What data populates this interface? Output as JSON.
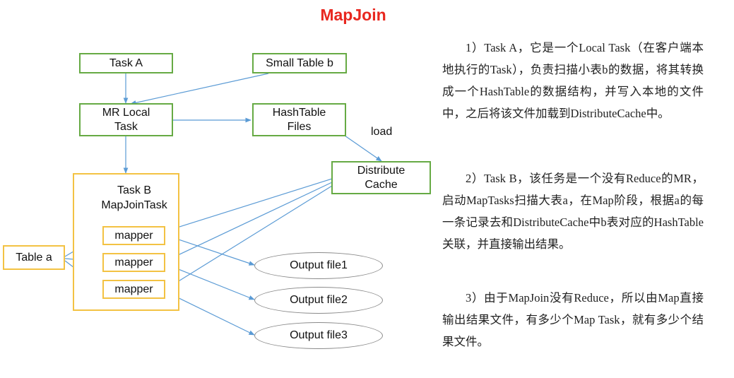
{
  "title": "MapJoin",
  "nodes": {
    "task_a": "Task A",
    "small_table": "Small Table b",
    "mr_local_task": "MR Local\nTask",
    "hashtable_files": "HashTable\nFiles",
    "distribute_cache": "Distribute\nCache",
    "task_b": "Task B\nMapJoinTask",
    "table_a": "Table a",
    "mappers": [
      "mapper",
      "mapper",
      "mapper"
    ],
    "outputs": [
      "Output file1",
      "Output file2",
      "Output file3"
    ]
  },
  "edge_labels": {
    "load": "load"
  },
  "description": [
    "1）Task A，它是一个Local Task（在客户端本地执行的Task），负责扫描小表b的数据，将其转换成一个HashTable的数据结构，并写入本地的文件中，之后将该文件加载到DistributeCache中。",
    "2）Task B，该任务是一个没有Reduce的MR，启动MapTasks扫描大表a，在Map阶段，根据a的每一条记录去和DistributeCache中b表对应的HashTable关联，并直接输出结果。",
    "3）由于MapJoin没有Reduce，所以由Map直接输出结果文件，有多少个Map Task，就有多少个结果文件。"
  ],
  "colors": {
    "title": "#e8271f",
    "green_border": "#66aa44",
    "yellow_border": "#f3c243",
    "arrow": "#5b9bd5",
    "oval_border": "#8a8a8a"
  }
}
